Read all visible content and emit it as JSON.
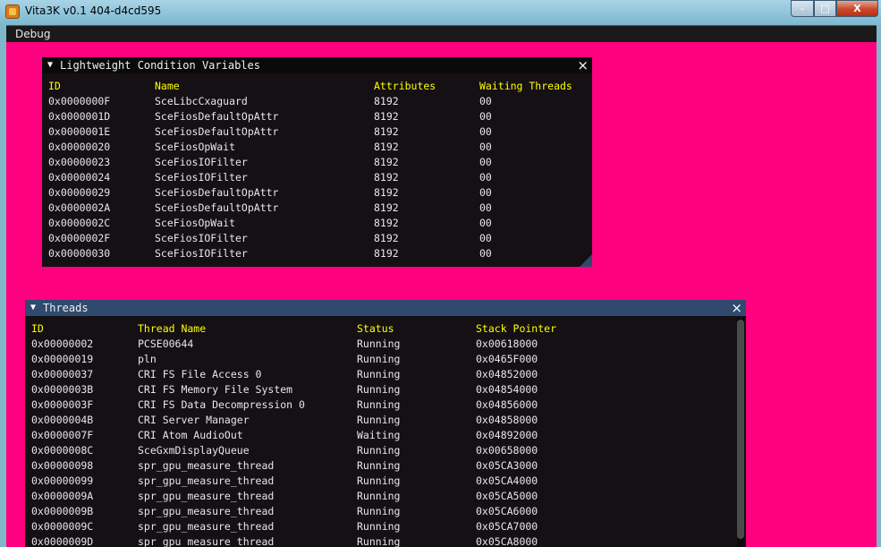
{
  "window": {
    "title": "Vita3K v0.1 404-d4cd595",
    "minimize": "–",
    "maximize": "□",
    "close": "X"
  },
  "menubar": {
    "debug": "Debug"
  },
  "colors": {
    "background": "#ff007f",
    "panel": "#141014",
    "header_text": "#ffff00",
    "threads_title": "#2f4a6e"
  },
  "lcv": {
    "title": "Lightweight Condition Variables",
    "close": "×",
    "columns": [
      "ID",
      "Name",
      "Attributes",
      "Waiting Threads"
    ],
    "rows": [
      [
        "0x0000000F",
        "SceLibcCxaguard",
        "8192",
        "00"
      ],
      [
        "0x0000001D",
        "SceFiosDefaultOpAttr",
        "8192",
        "00"
      ],
      [
        "0x0000001E",
        "SceFiosDefaultOpAttr",
        "8192",
        "00"
      ],
      [
        "0x00000020",
        "SceFiosOpWait",
        "8192",
        "00"
      ],
      [
        "0x00000023",
        "SceFiosIOFilter",
        "8192",
        "00"
      ],
      [
        "0x00000024",
        "SceFiosIOFilter",
        "8192",
        "00"
      ],
      [
        "0x00000029",
        "SceFiosDefaultOpAttr",
        "8192",
        "00"
      ],
      [
        "0x0000002A",
        "SceFiosDefaultOpAttr",
        "8192",
        "00"
      ],
      [
        "0x0000002C",
        "SceFiosOpWait",
        "8192",
        "00"
      ],
      [
        "0x0000002F",
        "SceFiosIOFilter",
        "8192",
        "00"
      ],
      [
        "0x00000030",
        "SceFiosIOFilter",
        "8192",
        "00"
      ]
    ]
  },
  "threads": {
    "title": "Threads",
    "close": "×",
    "columns": [
      "ID",
      "Thread Name",
      "Status",
      "Stack Pointer"
    ],
    "rows": [
      [
        "0x00000002",
        "PCSE00644",
        "Running",
        "0x00618000"
      ],
      [
        "0x00000019",
        "pln",
        "Running",
        "0x0465F000"
      ],
      [
        "0x00000037",
        "CRI FS File Access 0",
        "Running",
        "0x04852000"
      ],
      [
        "0x0000003B",
        "CRI FS Memory File System",
        "Running",
        "0x04854000"
      ],
      [
        "0x0000003F",
        "CRI FS Data Decompression 0",
        "Running",
        "0x04856000"
      ],
      [
        "0x0000004B",
        "CRI Server Manager",
        "Running",
        "0x04858000"
      ],
      [
        "0x0000007F",
        "CRI Atom AudioOut",
        "Waiting",
        "0x04892000"
      ],
      [
        "0x0000008C",
        "SceGxmDisplayQueue",
        "Running",
        "0x00658000"
      ],
      [
        "0x00000098",
        "spr_gpu_measure_thread",
        "Running",
        "0x05CA3000"
      ],
      [
        "0x00000099",
        "spr_gpu_measure_thread",
        "Running",
        "0x05CA4000"
      ],
      [
        "0x0000009A",
        "spr_gpu_measure_thread",
        "Running",
        "0x05CA5000"
      ],
      [
        "0x0000009B",
        "spr_gpu_measure_thread",
        "Running",
        "0x05CA6000"
      ],
      [
        "0x0000009C",
        "spr_gpu_measure_thread",
        "Running",
        "0x05CA7000"
      ],
      [
        "0x0000009D",
        "spr_gpu_measure_thread",
        "Running",
        "0x05CA8000"
      ]
    ]
  }
}
